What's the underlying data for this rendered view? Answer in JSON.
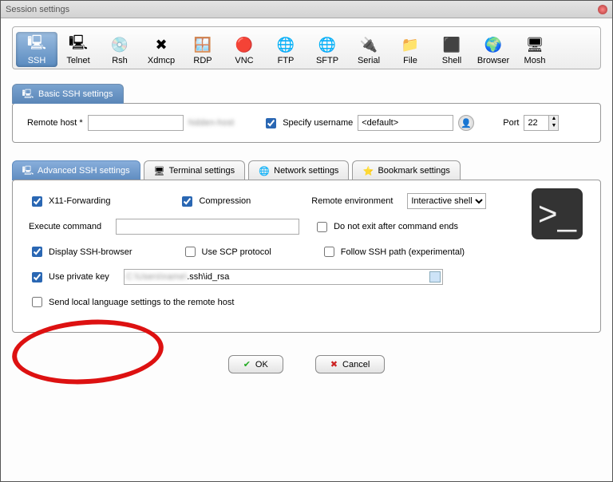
{
  "window": {
    "title": "Session settings"
  },
  "toolbar": {
    "items": [
      {
        "label": "SSH",
        "icon": "🖳"
      },
      {
        "label": "Telnet",
        "icon": "🖳"
      },
      {
        "label": "Rsh",
        "icon": "💿"
      },
      {
        "label": "Xdmcp",
        "icon": "✖"
      },
      {
        "label": "RDP",
        "icon": "🪟"
      },
      {
        "label": "VNC",
        "icon": "🔴"
      },
      {
        "label": "FTP",
        "icon": "🌐"
      },
      {
        "label": "SFTP",
        "icon": "🌐"
      },
      {
        "label": "Serial",
        "icon": "🔌"
      },
      {
        "label": "File",
        "icon": "📁"
      },
      {
        "label": "Shell",
        "icon": "⬛"
      },
      {
        "label": "Browser",
        "icon": "🌍"
      },
      {
        "label": "Mosh",
        "icon": "🖥"
      }
    ],
    "selected_index": 0
  },
  "basic": {
    "tab_label": "Basic SSH settings",
    "remote_host_label": "Remote host *",
    "remote_host_value": "",
    "specify_username_label": "Specify username",
    "specify_username_checked": true,
    "username_value": "<default>",
    "port_label": "Port",
    "port_value": "22"
  },
  "adv_tabs": {
    "items": [
      {
        "label": "Advanced SSH settings",
        "icon": "🖳"
      },
      {
        "label": "Terminal settings",
        "icon": "🖥"
      },
      {
        "label": "Network settings",
        "icon": "🌐"
      },
      {
        "label": "Bookmark settings",
        "icon": "⭐"
      }
    ],
    "active_index": 0
  },
  "advanced": {
    "x11_label": "X11-Forwarding",
    "x11_checked": true,
    "compression_label": "Compression",
    "compression_checked": true,
    "remote_env_label": "Remote environment",
    "remote_env_value": "Interactive shell",
    "exec_cmd_label": "Execute command",
    "exec_cmd_value": "",
    "no_exit_label": "Do not exit after command ends",
    "no_exit_checked": false,
    "display_browser_label": "Display SSH-browser",
    "display_browser_checked": true,
    "use_scp_label": "Use SCP protocol",
    "use_scp_checked": false,
    "follow_path_label": "Follow SSH path (experimental)",
    "follow_path_checked": false,
    "use_key_label": "Use private key",
    "use_key_checked": true,
    "key_path_value": ".ssh\\id_rsa",
    "send_lang_label": "Send local language settings to the remote host",
    "send_lang_checked": false
  },
  "buttons": {
    "ok": "OK",
    "cancel": "Cancel"
  }
}
